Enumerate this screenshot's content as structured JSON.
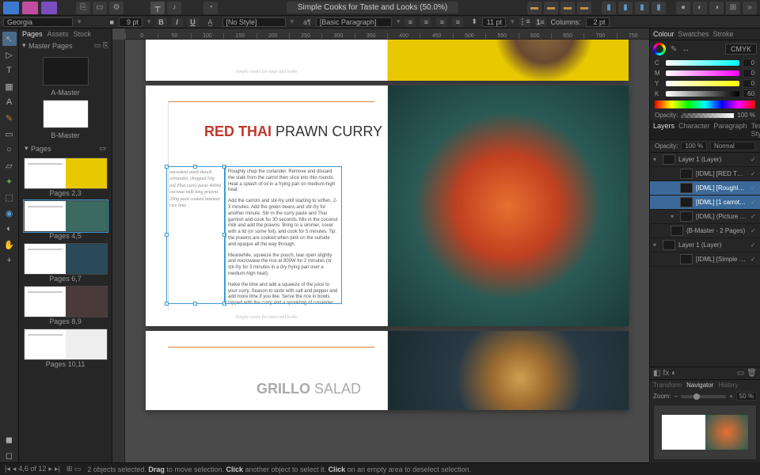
{
  "document": {
    "title": "Simple Cooks for Taste and Looks (50.0%)"
  },
  "context": {
    "font_family": "Georgia",
    "font_size": "9 pt",
    "char_style": "[No Style]",
    "para_style": "[Basic Paragraph]",
    "leading": "11 pt",
    "columns_label": "Columns:",
    "columns": "2 pt"
  },
  "pages_panel": {
    "tabs": [
      "Pages",
      "Assets",
      "Stock"
    ],
    "master_label": "Master Pages",
    "masters": [
      "A-Master",
      "B-Master"
    ],
    "pages_label": "Pages",
    "spreads": [
      "Pages 2,3",
      "Pages 4,5",
      "Pages 6,7",
      "Pages 8,9",
      "Pages 10,11"
    ]
  },
  "recipe": {
    "title_bold": "RED THAI",
    "title_rest": " PRAWN CURRY",
    "footer": "Simple cooks for taste and looks",
    "ingredients": "uncooked small bunch coriander, chopped 50g red Thai curry paste 400ml coconut milk king prawns 200g pack cooked basmati rice lime",
    "method_p1": "Roughly chop the coriander. Remove and discard the stalk from the carrot then slice into thin rounds. Heat a splash of oil in a frying pan on medium-high heat.",
    "method_p2": "Add the carrots and stir-fry until starting to soften, 2-3 minutes. Add the green beans and stir-fry for another minute. Stir in the curry paste and Thai garnish and cook for 30 seconds. Mix in the coconut milk and add the prawns. Bring to a simmer, cover with a lid (or some foil), and cook for 5 minutes. Tip: the prawns are cooked when pink on the outside and opaque all the way through.",
    "method_p3": "Meanwhile, squeeze the pouch, tear open slightly and microwave the rice at 800W for 2 minutes (or stir-fry for 3 minutes in a dry frying pan over a medium-high heat).",
    "method_p4": "Halve the lime and add a squeeze of the juice to your curry. Season to taste with salt and pepper and add more lime if you like. Serve the rice in bowls topped with the curry and a sprinkling of coriander."
  },
  "grillo": {
    "title_bold": "GRILLO",
    "title_rest": " SALAD"
  },
  "ruler": [
    "0",
    "50",
    "100",
    "150",
    "200",
    "250",
    "300",
    "350",
    "400",
    "450",
    "500",
    "550",
    "600",
    "650",
    "700",
    "750"
  ],
  "color": {
    "tab_labels": [
      "Colour",
      "Swatches",
      "Stroke"
    ],
    "mode": "CMYK",
    "c": {
      "label": "C",
      "value": "0"
    },
    "m": {
      "label": "M",
      "value": "0"
    },
    "y": {
      "label": "Y",
      "value": "0"
    },
    "k": {
      "label": "K",
      "value": "60"
    },
    "opacity_label": "Opacity:",
    "opacity": "100 %"
  },
  "layers": {
    "tab_labels": [
      "Layers",
      "Character",
      "Paragraph",
      "Text Styles"
    ],
    "opacity_label": "Opacity:",
    "opacity": "100 %",
    "blend": "Normal",
    "items": [
      {
        "name": "Layer 1 (Layer)",
        "type": "layer"
      },
      {
        "name": "[IDML] [RED THAI PRAWN C…",
        "type": "text"
      },
      {
        "name": "[IDML] [Roughly chop the c…",
        "type": "text",
        "selected": true
      },
      {
        "name": "[IDML] [1 carrot, sliced 1…",
        "type": "text",
        "selected": true
      },
      {
        "name": "[IDML] (Picture Frame)",
        "type": "image"
      },
      {
        "name": "(B-Master - 2 Pages)",
        "type": "master"
      },
      {
        "name": "Layer 1 (Layer)",
        "type": "layer"
      },
      {
        "name": "[IDML] [Simple cooks for …",
        "type": "text"
      }
    ]
  },
  "navigator": {
    "tabs": [
      "Transform",
      "Navigator",
      "History"
    ],
    "zoom_label": "Zoom:",
    "zoom": "50 %"
  },
  "status": {
    "page_pos": "4,6 of 12",
    "hint_count": "2 objects selected.",
    "hint_drag": "Drag",
    "hint_drag_t": " to move selection. ",
    "hint_click": "Click",
    "hint_click_t": " another object to select it. ",
    "hint_click2": "Click",
    "hint_click2_t": " on an empty area to deselect selection."
  }
}
